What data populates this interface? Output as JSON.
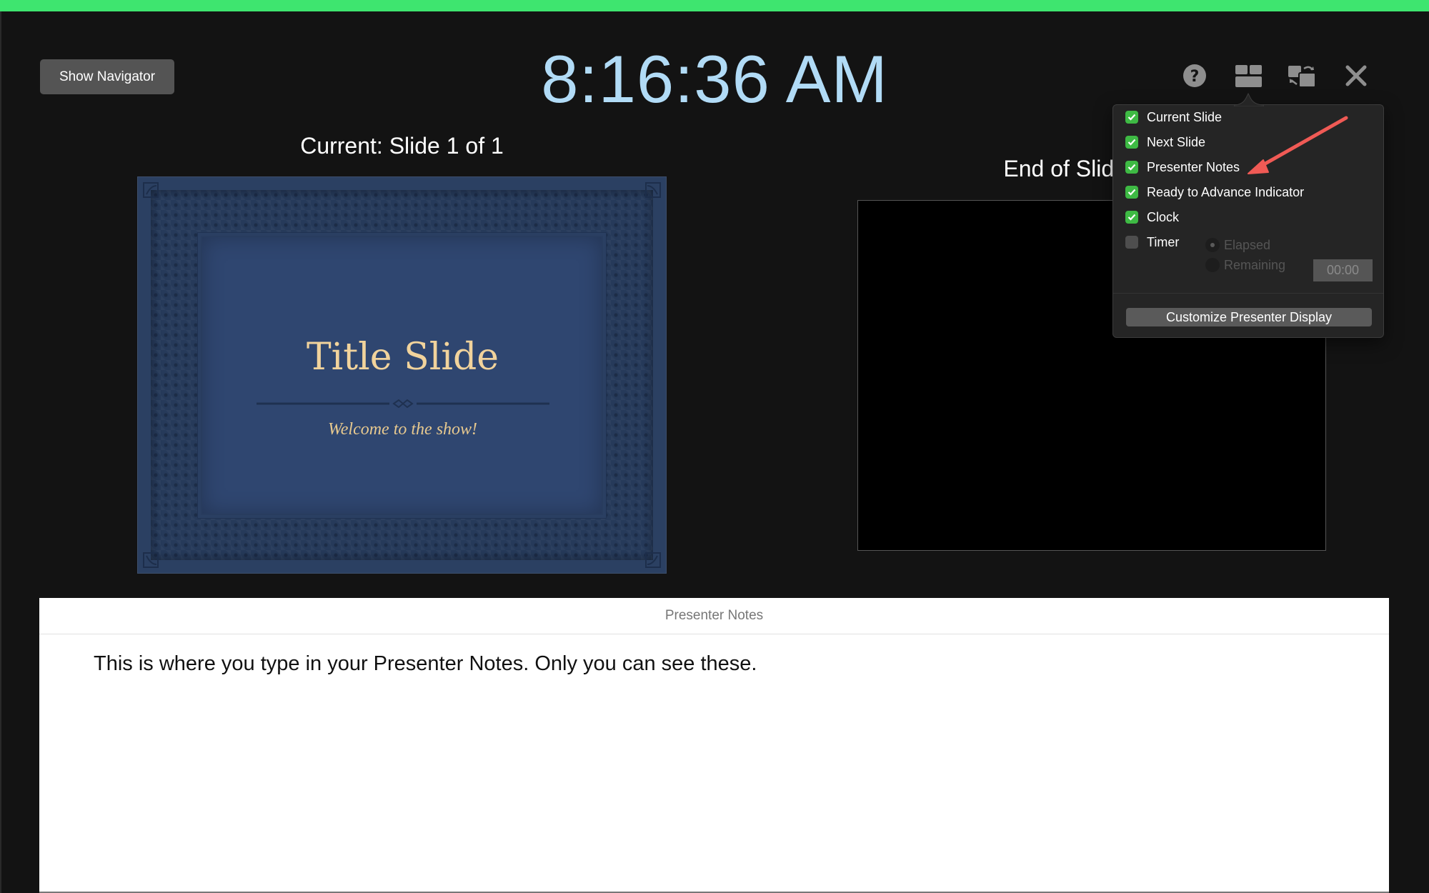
{
  "header": {
    "show_navigator_label": "Show Navigator",
    "clock": "8:16:36 AM"
  },
  "toolbar": {
    "icons": [
      "help-icon",
      "layout-icon",
      "swap-displays-icon",
      "close-icon"
    ]
  },
  "current_slide": {
    "label": "Current: Slide 1 of 1",
    "slide_title": "Title Slide",
    "slide_subtitle": "Welcome to the show!"
  },
  "next_slide": {
    "label": "End of Slideshow",
    "label_visible": "End of S"
  },
  "notes": {
    "header": "Presenter Notes",
    "body": "This is where you type in your Presenter Notes. Only you can see these."
  },
  "layout_popover": {
    "options": [
      {
        "label": "Current Slide",
        "checked": true
      },
      {
        "label": "Next Slide",
        "checked": true
      },
      {
        "label": "Presenter Notes",
        "checked": true
      },
      {
        "label": "Ready to Advance Indicator",
        "checked": true
      },
      {
        "label": "Clock",
        "checked": true
      },
      {
        "label": "Timer",
        "checked": false
      }
    ],
    "timer_modes": [
      {
        "label": "Elapsed",
        "selected": true,
        "enabled": false
      },
      {
        "label": "Remaining",
        "selected": false,
        "enabled": false
      }
    ],
    "timer_value": "00:00",
    "customize_label": "Customize Presenter Display"
  },
  "colors": {
    "accent_bar": "#3ee56f",
    "clock": "#b1dbf6",
    "checkbox_on": "#3eba44",
    "annotation_arrow": "#f05a55",
    "slide_title": "#f1d39c"
  }
}
